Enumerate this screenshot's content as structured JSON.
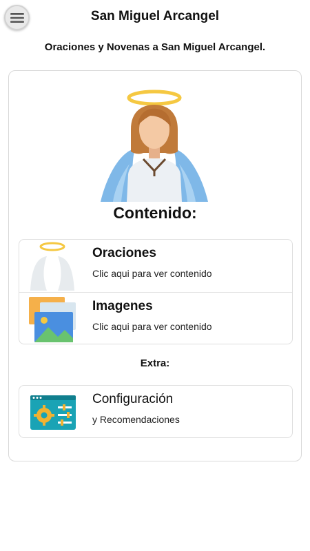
{
  "header": {
    "title": "San Miguel Arcangel",
    "subtitle": "Oraciones y Novenas a San Miguel Arcangel.",
    "menu_icon": "hamburger-menu-icon"
  },
  "content": {
    "hero_icon": "angel-icon",
    "section_title": "Contenido:",
    "items": [
      {
        "title": "Oraciones",
        "description": "Clic aqui para ver contenido",
        "icon": "halo-wings-icon"
      },
      {
        "title": "Imagenes",
        "description": "Clic aqui para ver contenido",
        "icon": "image-gallery-icon"
      }
    ],
    "extra_title": "Extra:",
    "extra_items": [
      {
        "title": "Configuración",
        "description": "y Recomendaciones",
        "icon": "settings-panel-icon"
      }
    ]
  },
  "colors": {
    "halo": "#f5c842",
    "wings": "#7fb8e8",
    "hair": "#c07a3a",
    "skin": "#f4c9a4",
    "robe": "#ecf0f4",
    "card_border": "#d8d8d8",
    "settings_panel": "#1aa3b5",
    "gear": "#f2b230"
  }
}
